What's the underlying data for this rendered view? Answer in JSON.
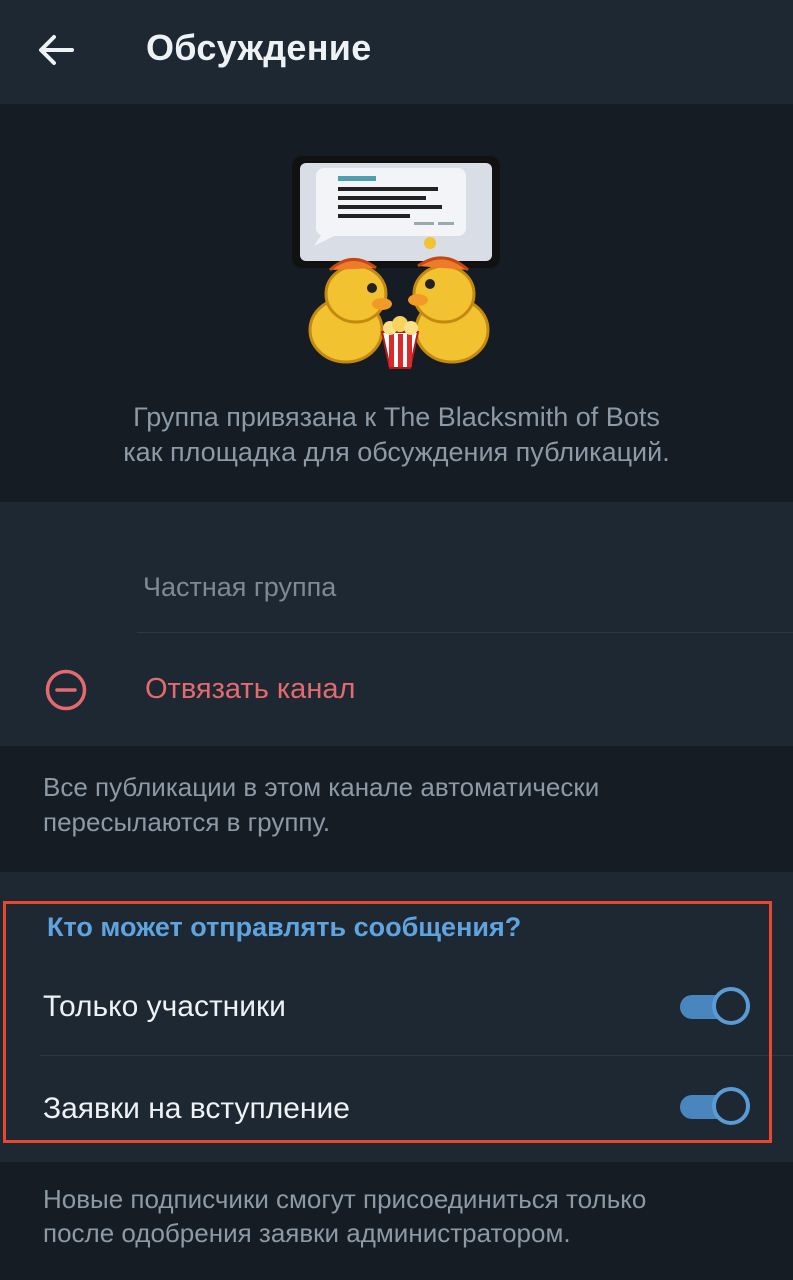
{
  "header": {
    "back_icon": "arrow-left-icon",
    "title": "Обсуждение"
  },
  "hero": {
    "sticker_icon": "ducks-watching-screen-sticker",
    "line1": "Группа привязана к The Blacksmith of Bots",
    "line2": "как площадка для обсуждения публикаций."
  },
  "linked": {
    "group_label": "Частная группа",
    "unlink_icon": "minus-circle-icon",
    "unlink_label": "Отвязать канал"
  },
  "info1": {
    "line1": "Все публикации в этом канале автоматически",
    "line2": "пересылаются в группу."
  },
  "permissions": {
    "section_title": "Кто может отправлять сообщения?",
    "toggles": [
      {
        "label": "Только участники",
        "on": true
      },
      {
        "label": "Заявки на вступление",
        "on": true
      }
    ]
  },
  "info2": {
    "line1": "Новые подписчики смогут присоединиться только",
    "line2": "после одобрения заявки администратором."
  },
  "colors": {
    "background": "#151c24",
    "card": "#1e2832",
    "accent_blue": "#5fa4de",
    "destructive_red": "#e36b6f",
    "highlight_red": "#e8472f"
  }
}
